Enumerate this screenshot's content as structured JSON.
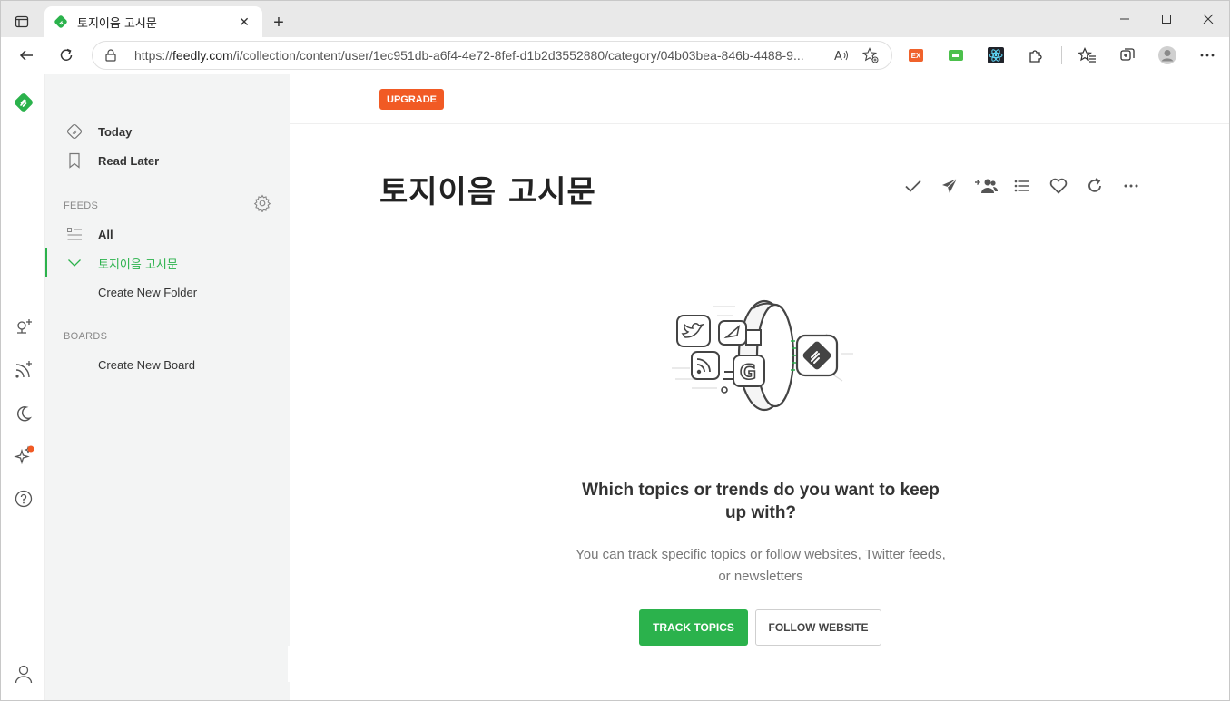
{
  "browser": {
    "tab_title": "토지이음 고시문",
    "url_prefix": "https://",
    "url_host": "feedly.com",
    "url_rest": "/i/collection/content/user/1ec951db-a6f4-4e72-8fef-d1b2d3552880/category/04b03bea-846b-4488-9...",
    "new_tab_label": "+",
    "close_tab_label": "✕",
    "icons": [
      "tab-actions-icon",
      "back-icon",
      "refresh-icon",
      "lock-icon",
      "read-aloud-icon",
      "add-favorite-icon",
      "extensions-icon",
      "favorites-icon",
      "collections-icon",
      "profile-icon",
      "more-icon"
    ],
    "extensions": [
      "ext-orange-icon",
      "ext-green-icon",
      "react-devtools-icon",
      "puzzle-icon"
    ]
  },
  "rail": {
    "icons": [
      "feedly-logo-icon",
      "add-source-icon",
      "add-feed-icon",
      "night-mode-icon",
      "ai-feature-icon",
      "help-icon",
      "account-icon"
    ]
  },
  "sidebar": {
    "today": "Today",
    "read_later": "Read Later",
    "feeds_section": "FEEDS",
    "all": "All",
    "active_feed": "토지이음 고시문",
    "create_folder": "Create New Folder",
    "boards_section": "BOARDS",
    "create_board": "Create New Board"
  },
  "main": {
    "upgrade_label": "UPGRADE",
    "title": "토지이음 고시문",
    "actions": [
      "mark-read-icon",
      "share-icon",
      "team-icon",
      "list-view-icon",
      "favorite-icon",
      "refresh-icon",
      "more-icon"
    ],
    "empty_title": "Which topics or trends do you want to keep up with?",
    "empty_subtitle": "You can track specific topics or follow websites, Twitter feeds, or newsletters",
    "track_topics_label": "TRACK TOPICS",
    "follow_website_label": "FOLLOW WEBSITE"
  },
  "colors": {
    "brand_green": "#2bb24c",
    "upgrade_orange": "#f15a24",
    "sidebar_bg": "#f3f4f4"
  }
}
